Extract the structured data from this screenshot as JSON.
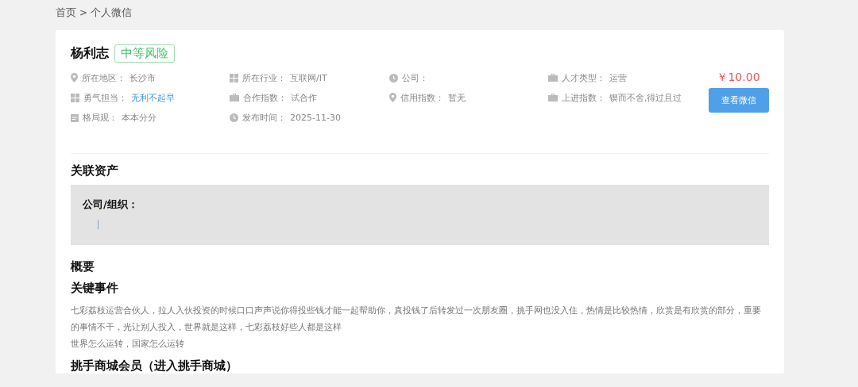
{
  "breadcrumb": [
    {
      "label": "首页"
    },
    {
      "label": "个人微信"
    }
  ],
  "breadcrumb_separator": ">",
  "profile": {
    "name": "杨利志",
    "risk_tag": "中等风险",
    "price": "￥10.00",
    "action": "查看微信",
    "info": [
      {
        "kind": "pin",
        "label": "所在地区：",
        "value": "长沙市",
        "highlight": false
      },
      {
        "kind": "grid",
        "label": "所在行业：",
        "value": "互联网/IT",
        "highlight": false
      },
      {
        "kind": "clock",
        "label": "公司："
      },
      {
        "kind": "briefcase",
        "label": "人才类型：",
        "value": "运营",
        "highlight": false
      },
      {
        "kind": "grid",
        "label": "勇气担当：",
        "value": "无利不起早",
        "highlight": true
      },
      {
        "kind": "briefcase",
        "label": "合作指数：",
        "value": "试合作",
        "highlight": false
      },
      {
        "kind": "pin",
        "label": "信用指数：",
        "value": "暂无",
        "highlight": false
      },
      {
        "kind": "briefcase",
        "label": "上进指数：",
        "value": "锲而不舍,得过且过",
        "highlight": false
      },
      {
        "kind": "calendar",
        "label": "格局观：",
        "value": "本本分分",
        "highlight": false
      },
      {
        "kind": "clock",
        "label": "发布时间：",
        "value": "2025-11-30",
        "highlight": false
      }
    ]
  },
  "assets": {
    "title": "关联资产",
    "box_label": "公司/组织："
  },
  "summary": {
    "title": "概要"
  },
  "key_events": {
    "title": "关键事件",
    "paragraphs": [
      "七彩荔枝运营合伙人，拉人入伙投资的时候口口声声说你得投些钱才能一起帮助你，真投钱了后转发过一次朋友圈，挑手网也没入住，热情是比较热情，欣赏是有欣赏的部分，重要的事情不干，光让别人投入，世界就是这样，七彩荔枝好些人都是这样",
      "世界怎么运转，国家怎么运转"
    ]
  },
  "membership": {
    "title": "挑手商城会员（进入挑手商城）"
  }
}
